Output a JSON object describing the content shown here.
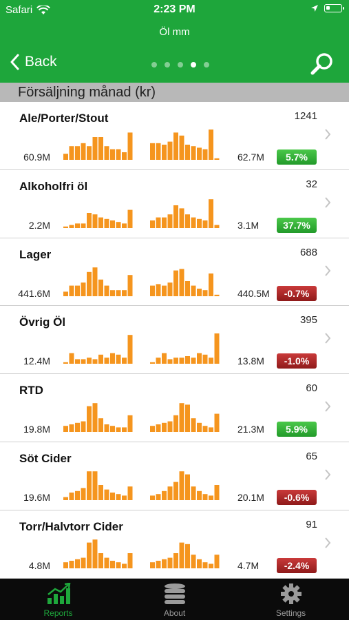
{
  "status": {
    "carrier": "Safari",
    "time": "2:23 PM"
  },
  "nav": {
    "site_title": "Öl mm",
    "back_label": "Back",
    "page_dots": 5,
    "active_dot": 3
  },
  "section": {
    "title": "Försäljning månad (kr)"
  },
  "colors": {
    "header_green": "#1ea63b",
    "bar_orange": "#f5951e",
    "positive": "#2faf32",
    "negative": "#a82424",
    "tab_active": "#1ea63b"
  },
  "rows": [
    {
      "name": "Ale/Porter/Stout",
      "count": "1241",
      "left_value": "60.9M",
      "right_value": "62.7M",
      "change": "5.7%",
      "trend": "pos",
      "bars_a": [
        0.2,
        0.45,
        0.45,
        0.55,
        0.45,
        0.75,
        0.75,
        0.45,
        0.35,
        0.35,
        0.25,
        0.9
      ],
      "bars_b": [
        0.55,
        0.55,
        0.5,
        0.6,
        0.9,
        0.8,
        0.5,
        0.45,
        0.4,
        0.35,
        1.0,
        0.05
      ]
    },
    {
      "name": "Alkoholfri öl",
      "count": "32",
      "left_value": "2.2M",
      "right_value": "3.1M",
      "change": "37.7%",
      "trend": "pos",
      "bars_a": [
        0.05,
        0.1,
        0.15,
        0.15,
        0.5,
        0.45,
        0.35,
        0.3,
        0.25,
        0.2,
        0.15,
        0.6
      ],
      "bars_b": [
        0.25,
        0.35,
        0.35,
        0.45,
        0.75,
        0.65,
        0.45,
        0.35,
        0.3,
        0.25,
        0.95,
        0.1
      ]
    },
    {
      "name": "Lager",
      "count": "688",
      "left_value": "441.6M",
      "right_value": "440.5M",
      "change": "-0.7%",
      "trend": "neg",
      "bars_a": [
        0.15,
        0.35,
        0.35,
        0.45,
        0.8,
        0.95,
        0.55,
        0.35,
        0.2,
        0.2,
        0.2,
        0.7
      ],
      "bars_b": [
        0.35,
        0.4,
        0.35,
        0.45,
        0.85,
        0.9,
        0.5,
        0.35,
        0.25,
        0.2,
        0.75,
        0.05
      ]
    },
    {
      "name": "Övrig Öl",
      "count": "395",
      "left_value": "12.4M",
      "right_value": "13.8M",
      "change": "-1.0%",
      "trend": "neg",
      "bars_a": [
        0.05,
        0.35,
        0.15,
        0.15,
        0.2,
        0.15,
        0.3,
        0.2,
        0.35,
        0.3,
        0.2,
        0.95
      ],
      "bars_b": [
        0.05,
        0.2,
        0.35,
        0.15,
        0.2,
        0.2,
        0.25,
        0.2,
        0.35,
        0.3,
        0.2,
        1.0
      ]
    },
    {
      "name": "RTD",
      "count": "60",
      "left_value": "19.8M",
      "right_value": "21.3M",
      "change": "5.9%",
      "trend": "pos",
      "bars_a": [
        0.2,
        0.25,
        0.3,
        0.35,
        0.85,
        0.95,
        0.45,
        0.25,
        0.2,
        0.15,
        0.15,
        0.55
      ],
      "bars_b": [
        0.2,
        0.25,
        0.3,
        0.35,
        0.55,
        0.95,
        0.9,
        0.45,
        0.3,
        0.2,
        0.15,
        0.6
      ]
    },
    {
      "name": "Söt Cider",
      "count": "65",
      "left_value": "19.6M",
      "right_value": "20.1M",
      "change": "-0.6%",
      "trend": "neg",
      "bars_a": [
        0.1,
        0.25,
        0.3,
        0.4,
        0.95,
        0.95,
        0.5,
        0.35,
        0.25,
        0.2,
        0.15,
        0.45
      ],
      "bars_b": [
        0.15,
        0.2,
        0.3,
        0.45,
        0.6,
        0.95,
        0.85,
        0.45,
        0.3,
        0.2,
        0.15,
        0.5
      ]
    },
    {
      "name": "Torr/Halvtorr Cider",
      "count": "91",
      "left_value": "4.8M",
      "right_value": "4.7M",
      "change": "-2.4%",
      "trend": "neg",
      "bars_a": [
        0.2,
        0.25,
        0.3,
        0.35,
        0.85,
        0.95,
        0.5,
        0.35,
        0.25,
        0.2,
        0.15,
        0.5
      ],
      "bars_b": [
        0.2,
        0.25,
        0.3,
        0.35,
        0.5,
        0.85,
        0.8,
        0.45,
        0.3,
        0.2,
        0.15,
        0.45
      ]
    }
  ],
  "tabs": [
    {
      "label": "Reports",
      "icon": "chart-icon",
      "active": true
    },
    {
      "label": "About",
      "icon": "database-icon",
      "active": false
    },
    {
      "label": "Settings",
      "icon": "gear-icon",
      "active": false
    }
  ]
}
